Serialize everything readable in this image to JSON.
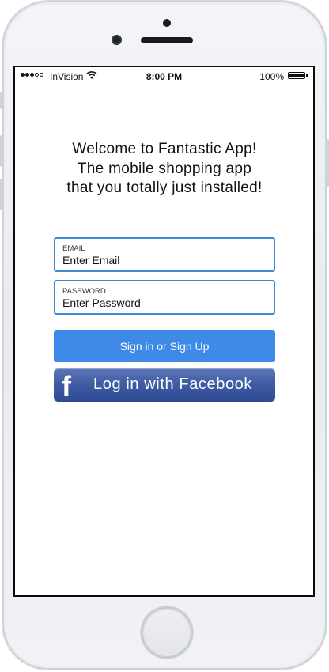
{
  "status_bar": {
    "carrier": "InVision",
    "time": "8:00 PM",
    "battery_percent": "100%"
  },
  "welcome": {
    "text": "Welcome to Fantastic App! The mobile shopping app that you totally just installed!"
  },
  "email_field": {
    "label": "EMAIL",
    "placeholder": "Enter Email"
  },
  "password_field": {
    "label": "PASSWORD",
    "placeholder": "Enter Password"
  },
  "buttons": {
    "signin": "Sign in or Sign Up",
    "facebook": "Log in with Facebook",
    "facebook_icon": "f"
  },
  "colors": {
    "accent": "#3e8ae6",
    "field_border": "#3f8ad6",
    "facebook": "#3e5ba3"
  },
  "icons": [
    "signal-icon",
    "wifi-icon",
    "battery-icon",
    "facebook-icon"
  ]
}
